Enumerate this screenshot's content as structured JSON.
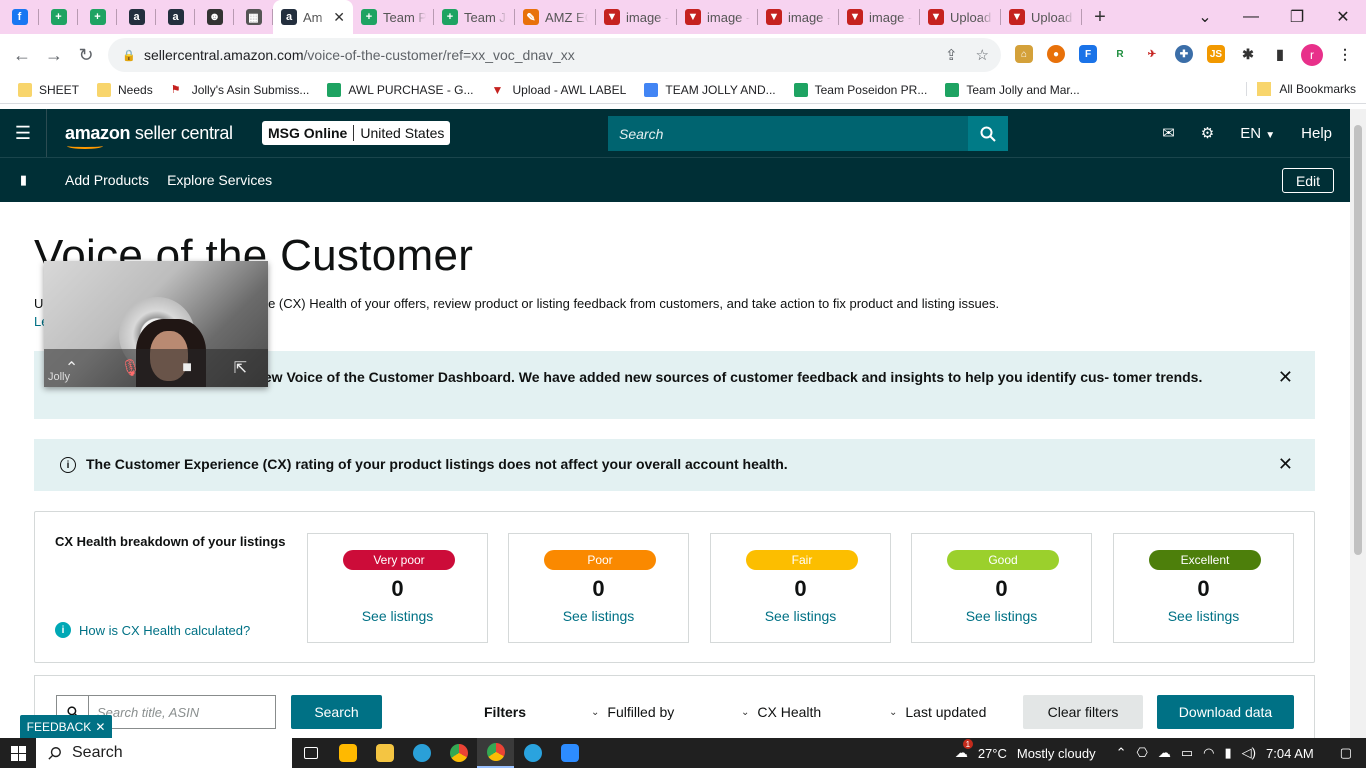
{
  "browser": {
    "tabs": [
      {
        "type": "pinned",
        "icon": "facebook-icon",
        "color": "#1877f2",
        "glyph": "f"
      },
      {
        "type": "pinned",
        "icon": "google-sheets-icon",
        "color": "#1ea362",
        "glyph": "+"
      },
      {
        "type": "pinned",
        "icon": "google-sheets-icon",
        "color": "#1ea362",
        "glyph": "+"
      },
      {
        "type": "pinned",
        "icon": "amazon-icon",
        "color": "#232f3e",
        "glyph": "a"
      },
      {
        "type": "pinned",
        "icon": "amazon-icon",
        "color": "#232f3e",
        "glyph": "a"
      },
      {
        "type": "pinned",
        "icon": "extension-icon",
        "color": "#333333",
        "glyph": "☻"
      },
      {
        "type": "pinned",
        "icon": "calculator-icon",
        "color": "#555555",
        "glyph": "▦"
      },
      {
        "type": "active",
        "icon": "amazon-icon",
        "color": "#232f3e",
        "glyph": "a",
        "title": "Am"
      },
      {
        "type": "normal",
        "icon": "google-sheets-icon",
        "color": "#1ea362",
        "glyph": "+",
        "title": "Team Pc"
      },
      {
        "type": "normal",
        "icon": "google-sheets-icon",
        "color": "#1ea362",
        "glyph": "+",
        "title": "Team Jo"
      },
      {
        "type": "normal",
        "icon": "pencil-icon",
        "color": "#e8710a",
        "glyph": "✎",
        "title": "AMZ EC"
      },
      {
        "type": "normal",
        "icon": "vector-icon",
        "color": "#c5221f",
        "glyph": "▼",
        "title": "image -"
      },
      {
        "type": "normal",
        "icon": "vector-icon",
        "color": "#c5221f",
        "glyph": "▼",
        "title": "image -"
      },
      {
        "type": "normal",
        "icon": "vector-icon",
        "color": "#c5221f",
        "glyph": "▼",
        "title": "image -"
      },
      {
        "type": "normal",
        "icon": "vector-icon",
        "color": "#c5221f",
        "glyph": "▼",
        "title": "image -"
      },
      {
        "type": "normal",
        "icon": "vector-icon",
        "color": "#c5221f",
        "glyph": "▼",
        "title": "Upload"
      },
      {
        "type": "normal",
        "icon": "vector-icon",
        "color": "#c5221f",
        "glyph": "▼",
        "title": "Upload"
      }
    ],
    "url_host": "sellercentral.amazon.com",
    "url_path": "/voice-of-the-customer/ref=xx_voc_dnav_xx",
    "profile_initial": "r",
    "bookmarks": [
      {
        "label": "SHEET",
        "kind": "folder",
        "icon": "folder-icon"
      },
      {
        "label": "Needs",
        "kind": "folder",
        "icon": "folder-icon"
      },
      {
        "label": "Jolly's Asin Submiss...",
        "kind": "flag",
        "icon": "flag-icon"
      },
      {
        "label": "AWL PURCHASE - G...",
        "kind": "gsheet",
        "icon": "google-sheets-icon"
      },
      {
        "label": "Upload - AWL LABEL",
        "kind": "vector",
        "icon": "vector-icon"
      },
      {
        "label": "TEAM JOLLY AND...",
        "kind": "gdoc",
        "icon": "google-docs-icon"
      },
      {
        "label": "Team Poseidon PR...",
        "kind": "gsheet",
        "icon": "google-sheets-icon"
      },
      {
        "label": "Team Jolly and Mar...",
        "kind": "gsheet",
        "icon": "google-sheets-icon"
      }
    ],
    "all_bookmarks": "All Bookmarks"
  },
  "header": {
    "logo_bold": "amazon",
    "logo_thin": " seller central",
    "account_name": "MSG Online",
    "account_region": "United States",
    "search_placeholder": "Search",
    "language": "EN",
    "help": "Help"
  },
  "subnav": {
    "links": [
      "Add Products",
      "Explore Services"
    ],
    "edit": "Edit"
  },
  "main": {
    "title": "Voice of the Customer",
    "intro": "U                                          er Experience (CX) Health of your offers, review product or listing feedback from customers, and take action to fix product and listing issues.",
    "intro_link": "Le",
    "banner1": "You are experiencing the new Voice of the Customer Dashboard. We have added new sources of customer feedback and insights to help you identify cus- tomer trends.",
    "banner2": "The Customer Experience (CX) rating of your product listings does not affect your overall account health.",
    "cx_title": "CX Health breakdown of your listings",
    "cx_how": "How is CX Health calculated?",
    "cx_cards": [
      {
        "label": "Very poor",
        "count": "0",
        "link": "See listings",
        "color": "#cc0c39"
      },
      {
        "label": "Poor",
        "count": "0",
        "link": "See listings",
        "color": "#fa8900"
      },
      {
        "label": "Fair",
        "count": "0",
        "link": "See listings",
        "color": "#fcbe00"
      },
      {
        "label": "Good",
        "count": "0",
        "link": "See listings",
        "color": "#9bd02c"
      },
      {
        "label": "Excellent",
        "count": "0",
        "link": "See listings",
        "color": "#4d7f0b"
      }
    ],
    "filter_placeholder": "Search title, ASIN",
    "search_button": "Search",
    "filters_label": "Filters",
    "filter_dropdowns": [
      "Fulfilled by",
      "CX Health",
      "Last updated"
    ],
    "clear_filters": "Clear filters",
    "download_data": "Download data",
    "feedback": "FEEDBACK"
  },
  "video_call": {
    "name": "Jolly"
  },
  "taskbar": {
    "search": "Search",
    "weather_temp": "27°C",
    "weather_desc": "Mostly cloudy",
    "weather_badge": "1",
    "time": "7:04 AM"
  }
}
